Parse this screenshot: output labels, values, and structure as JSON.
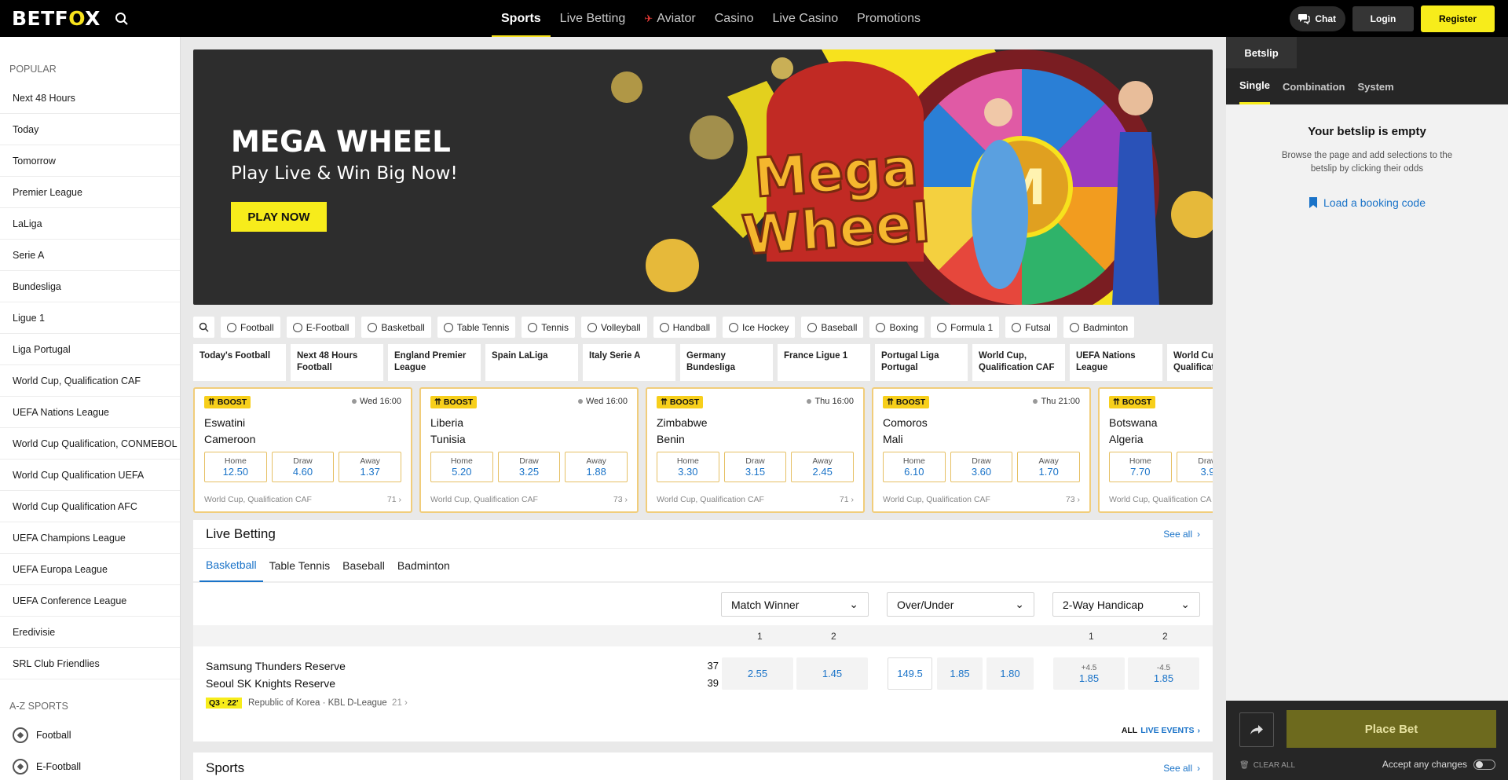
{
  "header": {
    "logo_prefix": "BETF",
    "logo_fox": "O",
    "logo_suffix": "X",
    "nav": [
      "Sports",
      "Live Betting",
      "Aviator",
      "Casino",
      "Live Casino",
      "Promotions"
    ],
    "chat_label": "Chat",
    "login_label": "Login",
    "register_label": "Register"
  },
  "sidebar": {
    "popular_heading": "POPULAR",
    "popular": [
      "Next 48 Hours",
      "Today",
      "Tomorrow",
      "Premier League",
      "LaLiga",
      "Serie A",
      "Bundesliga",
      "Ligue 1",
      "Liga Portugal",
      "World Cup, Qualification CAF",
      "UEFA Nations League",
      "World Cup Qualification, CONMEBOL",
      "World Cup Qualification UEFA",
      "World Cup Qualification AFC",
      "UEFA Champions League",
      "UEFA Europa League",
      "UEFA Conference League",
      "Eredivisie",
      "SRL Club Friendlies"
    ],
    "az_heading": "A-Z SPORTS",
    "az": [
      "Football",
      "E-Football"
    ]
  },
  "banner": {
    "title": "MEGA WHEEL",
    "subtitle": "Play Live & Win Big Now!",
    "button": "PLAY NOW",
    "art_line1": "Mega",
    "art_line2": "Wheel",
    "art_wheel_letter": "M"
  },
  "sport_chips": [
    "Football",
    "E-Football",
    "Basketball",
    "Table Tennis",
    "Tennis",
    "Volleyball",
    "Handball",
    "Ice Hockey",
    "Baseball",
    "Boxing",
    "Formula 1",
    "Futsal",
    "Badminton"
  ],
  "leagues": [
    "Today's Football",
    "Next 48 Hours Football",
    "England Premier League",
    "Spain LaLiga",
    "Italy Serie A",
    "Germany Bundesliga",
    "France Ligue 1",
    "Portugal Liga Portugal",
    "World Cup, Qualification CAF",
    "UEFA Nations League",
    "World Cup, Qualification"
  ],
  "matches": [
    {
      "boost": "BOOST",
      "time": "Wed 16:00",
      "home": "Eswatini",
      "away": "Cameroon",
      "odds": [
        [
          "Home",
          "12.50"
        ],
        [
          "Draw",
          "4.60"
        ],
        [
          "Away",
          "1.37"
        ]
      ],
      "league": "World Cup, Qualification CAF",
      "markets": "71"
    },
    {
      "boost": "BOOST",
      "time": "Wed 16:00",
      "home": "Liberia",
      "away": "Tunisia",
      "odds": [
        [
          "Home",
          "5.20"
        ],
        [
          "Draw",
          "3.25"
        ],
        [
          "Away",
          "1.88"
        ]
      ],
      "league": "World Cup, Qualification CAF",
      "markets": "73"
    },
    {
      "boost": "BOOST",
      "time": "Thu 16:00",
      "home": "Zimbabwe",
      "away": "Benin",
      "odds": [
        [
          "Home",
          "3.30"
        ],
        [
          "Draw",
          "3.15"
        ],
        [
          "Away",
          "2.45"
        ]
      ],
      "league": "World Cup, Qualification CAF",
      "markets": "71"
    },
    {
      "boost": "BOOST",
      "time": "Thu 21:00",
      "home": "Comoros",
      "away": "Mali",
      "odds": [
        [
          "Home",
          "6.10"
        ],
        [
          "Draw",
          "3.60"
        ],
        [
          "Away",
          "1.70"
        ]
      ],
      "league": "World Cup, Qualification CAF",
      "markets": "73"
    },
    {
      "boost": "BOOST",
      "time": "",
      "home": "Botswana",
      "away": "Algeria",
      "odds": [
        [
          "Home",
          "7.70"
        ],
        [
          "Draw",
          "3.9"
        ],
        [
          "Away",
          ""
        ]
      ],
      "league": "World Cup, Qualification CA",
      "markets": ""
    }
  ],
  "live": {
    "title": "Live Betting",
    "see_all": "See all",
    "tabs": [
      "Basketball",
      "Table Tennis",
      "Baseball",
      "Badminton"
    ],
    "selects": [
      "Match Winner",
      "Over/Under",
      "2-Way Handicap"
    ],
    "col_1a": "1",
    "col_2a": "2",
    "col_1b": "1",
    "col_2b": "2",
    "row": {
      "home": "Samsung Thunders Reserve",
      "away": "Seoul SK Knights Reserve",
      "home_score": "37",
      "away_score": "39",
      "period": "Q3 · 22'",
      "league": "Republic of Korea · KBL D-League",
      "markets": "21",
      "mw1": "2.55",
      "mw2": "1.45",
      "ou_line": "149.5",
      "ou_over": "1.85",
      "ou_under": "1.80",
      "h1_line": "+4.5",
      "h1": "1.85",
      "h2_line": "-4.5",
      "h2": "1.85"
    },
    "all_prefix": "ALL",
    "all_suffix": "LIVE EVENTS"
  },
  "sports_section": {
    "title": "Sports",
    "see_all": "See all"
  },
  "betslip": {
    "tab": "Betslip",
    "modes": [
      "Single",
      "Combination",
      "System"
    ],
    "empty_title": "Your betslip is empty",
    "empty_text": "Browse the page and add selections to the betslip by clicking their odds",
    "booking": "Load a booking code",
    "place_bet": "Place Bet",
    "clear_all": "CLEAR ALL",
    "accept": "Accept any changes"
  },
  "colors": {
    "brand_yellow": "#f7ec1b",
    "link_blue": "#1a73c8",
    "boost_border": "#f1cd7a"
  }
}
